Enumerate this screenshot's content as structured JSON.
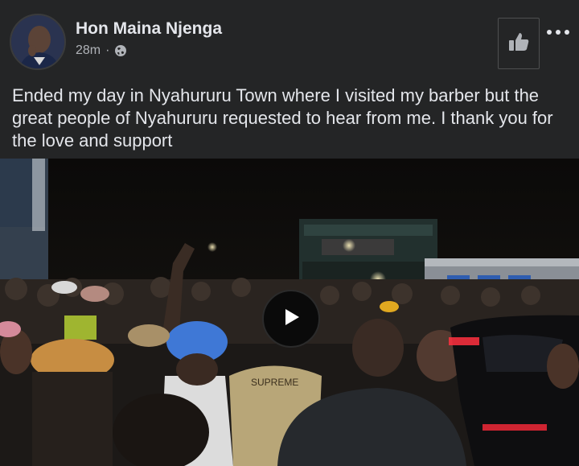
{
  "post": {
    "author": "Hon Maina Njenga",
    "time": "28m",
    "separator": "·",
    "text": "Ended my day in Nyahururu Town where I visited my barber but the great people of Nyahururu requested to hear from me. I thank you for the love and support",
    "privacy_icon": "globe-icon"
  },
  "actions": {
    "like_icon": "thumbs-up-icon",
    "more_icon": "more-dots-icon"
  },
  "media": {
    "type": "video",
    "play_icon": "play-icon",
    "shirt_text": "SUPREME"
  },
  "colors": {
    "background": "#242526",
    "text_primary": "#e4e6eb",
    "text_secondary": "#b0b3b8"
  }
}
